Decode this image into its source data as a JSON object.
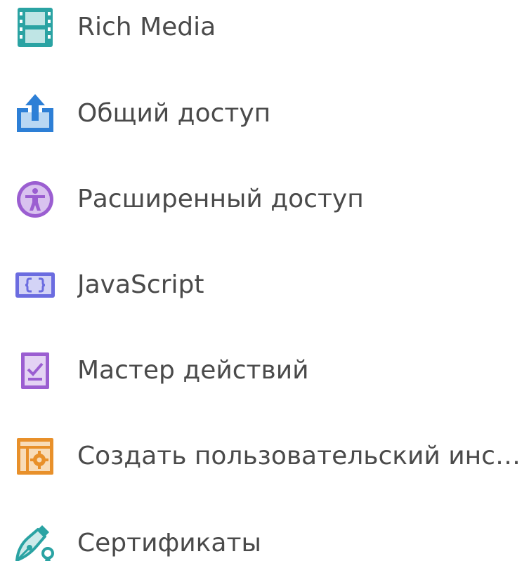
{
  "tools": [
    {
      "label": "Rich Media",
      "icon": "film-strip-icon",
      "color": "#2aa3a3"
    },
    {
      "label": "Общий доступ",
      "icon": "share-upload-icon",
      "color": "#2d7fd6"
    },
    {
      "label": "Расширенный доступ",
      "icon": "accessibility-icon",
      "color": "#9b5ed1"
    },
    {
      "label": "JavaScript",
      "icon": "code-braces-icon",
      "color": "#6b6ce0"
    },
    {
      "label": "Мастер действий",
      "icon": "action-wizard-icon",
      "color": "#9b5ed1"
    },
    {
      "label": "Создать пользовательский инст...",
      "icon": "custom-tool-gear-icon",
      "color": "#e8902a"
    },
    {
      "label": "Сертификаты",
      "icon": "certificate-pen-icon",
      "color": "#2aa3a3"
    }
  ]
}
